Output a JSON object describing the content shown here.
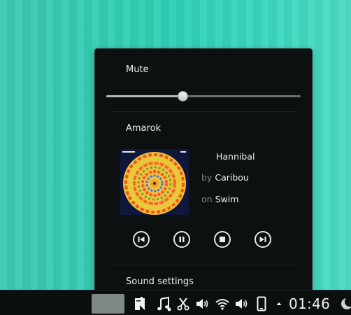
{
  "menu": {
    "mute_label": "Mute",
    "volume_percent": 39,
    "player_name": "Amarok",
    "track": {
      "title": "Hannibal",
      "artist_prefix": "by",
      "artist": "Caribou",
      "album_prefix": "on",
      "album": "Swim"
    },
    "controls": [
      "previous-icon",
      "pause-icon",
      "stop-icon",
      "next-icon"
    ],
    "sound_settings_label": "Sound settings"
  },
  "panel": {
    "clock": "01:46",
    "tray_icons": [
      "notes-icon",
      "music-icon",
      "scissors-icon",
      "volume-icon",
      "wifi-icon",
      "volume-icon",
      "phone-icon",
      "arrow-up-icon",
      "moon-icon"
    ]
  },
  "colors": {
    "desktop": "#36cbb4",
    "menu_bg": "#0d1010",
    "panel_bg": "#0c0f0f"
  }
}
